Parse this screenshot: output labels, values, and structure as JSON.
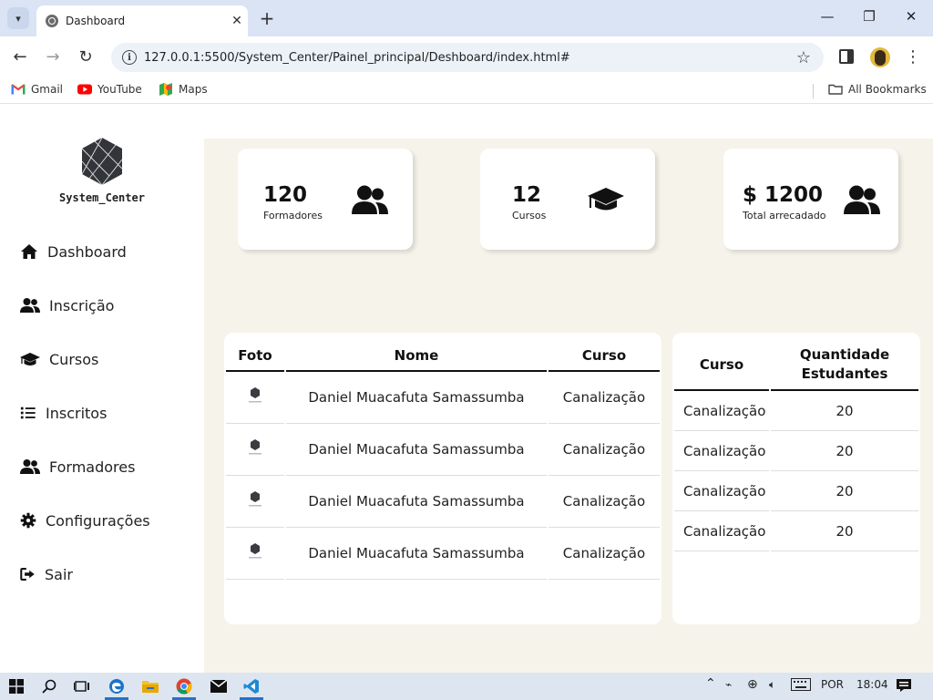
{
  "browser": {
    "tab_title": "Dashboard",
    "url": "127.0.0.1:5500/System_Center/Painel_principal/Deshboard/index.html#",
    "bookmarks": [
      {
        "label": "Gmail",
        "icon": "gmail-icon"
      },
      {
        "label": "YouTube",
        "icon": "youtube-icon"
      },
      {
        "label": "Maps",
        "icon": "maps-icon"
      }
    ],
    "all_bookmarks": "All Bookmarks"
  },
  "sidebar": {
    "brand": "System_Center",
    "items": [
      {
        "label": "Dashboard",
        "icon": "home-icon"
      },
      {
        "label": "Inscrição",
        "icon": "users-icon"
      },
      {
        "label": "Cursos",
        "icon": "graduation-cap-icon"
      },
      {
        "label": "Inscritos",
        "icon": "list-icon"
      },
      {
        "label": "Formadores",
        "icon": "users-icon"
      },
      {
        "label": "Configurações",
        "icon": "gear-icon"
      },
      {
        "label": "Sair",
        "icon": "sign-out-icon"
      }
    ]
  },
  "stats": [
    {
      "value": "120",
      "label": "Formadores",
      "icon": "users-icon"
    },
    {
      "value": "12",
      "label": "Cursos",
      "icon": "graduation-cap-icon"
    },
    {
      "value": "$ 1200",
      "label": "Total arrecadado",
      "icon": "users-icon"
    }
  ],
  "students_table": {
    "headers": [
      "Foto",
      "Nome",
      "Curso"
    ],
    "rows": [
      {
        "nome": "Daniel Muacafuta Samassumba",
        "curso": "Canalização"
      },
      {
        "nome": "Daniel Muacafuta Samassumba",
        "curso": "Canalização"
      },
      {
        "nome": "Daniel Muacafuta Samassumba",
        "curso": "Canalização"
      },
      {
        "nome": "Daniel Muacafuta Samassumba",
        "curso": "Canalização"
      }
    ]
  },
  "courses_table": {
    "headers": [
      "Curso",
      "Quantidade Estudantes"
    ],
    "rows": [
      {
        "curso": "Canalização",
        "quantidade": "20"
      },
      {
        "curso": "Canalização",
        "quantidade": "20"
      },
      {
        "curso": "Canalização",
        "quantidade": "20"
      },
      {
        "curso": "Canalização",
        "quantidade": "20"
      }
    ]
  },
  "taskbar": {
    "language": "POR",
    "time": "18:04"
  }
}
